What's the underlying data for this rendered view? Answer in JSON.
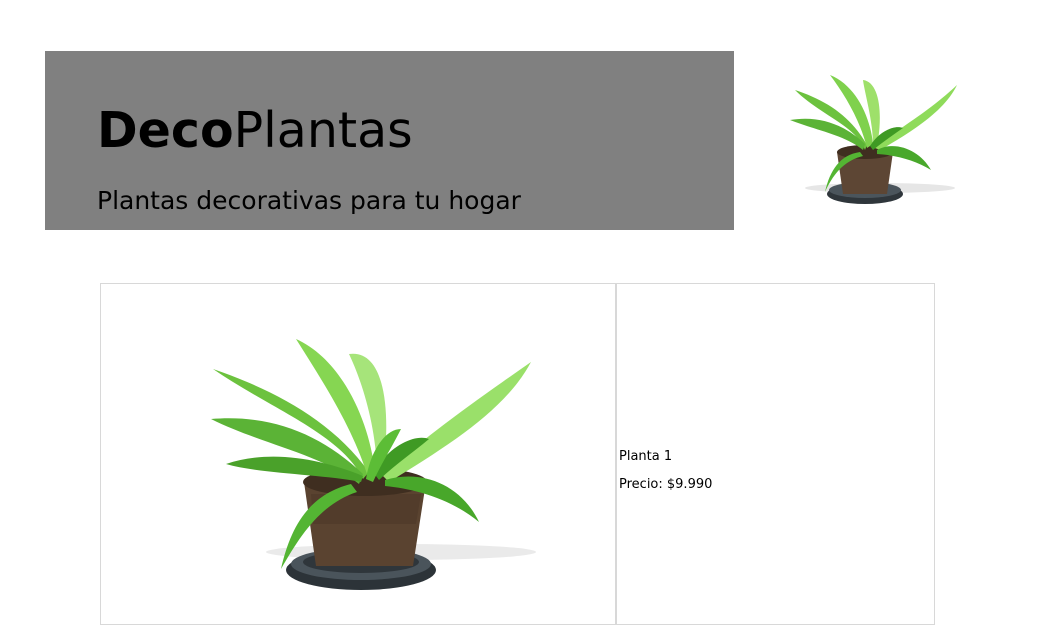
{
  "header": {
    "brand_bold": "Deco",
    "brand_regular": "Plantas",
    "tagline": "Plantas decorativas para tu hogar"
  },
  "product": {
    "name": "Planta 1",
    "price": "Precio: $9.990"
  },
  "colors": {
    "banner": "#808080",
    "leaf_light": "#8ed65a",
    "leaf_dark": "#4aa12a",
    "pot": "#5a4330",
    "tray": "#3a4248"
  }
}
